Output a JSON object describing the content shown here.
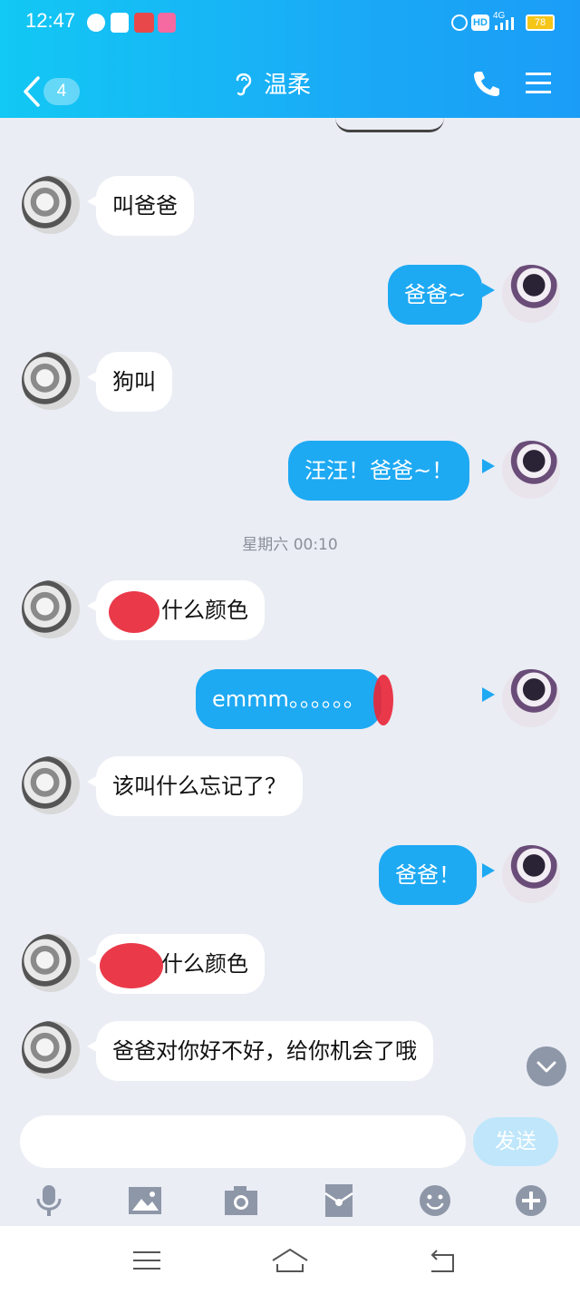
{
  "status_bar": {
    "time": "12:47",
    "hd_label": "HD",
    "network_label": "4G",
    "battery": "78"
  },
  "header": {
    "back_count": "4",
    "title": "温柔"
  },
  "messages": [
    {
      "side": "left",
      "text": "叫爸爸"
    },
    {
      "side": "right",
      "text": "爸爸~"
    },
    {
      "side": "left",
      "text": "狗叫"
    },
    {
      "side": "right",
      "text": "汪汪！爸爸~！"
    },
    {
      "side": "left",
      "text": "什么颜色"
    },
    {
      "side": "right",
      "text": "emmm。。。。。。"
    },
    {
      "side": "left",
      "text": "该叫什么忘记了？"
    },
    {
      "side": "right",
      "text": "爸爸！"
    },
    {
      "side": "left",
      "text": "什么颜色"
    },
    {
      "side": "left",
      "text": "爸爸对你好不好，给你机会了哦"
    }
  ],
  "timestamp": "星期六  00:10",
  "input": {
    "value": "",
    "send_label": "发送"
  },
  "toolbar": [
    "microphone-icon",
    "image-icon",
    "camera-icon",
    "red-envelope-icon",
    "emoji-icon",
    "plus-icon"
  ],
  "colors": {
    "header_start": "#12c8f4",
    "header_end": "#1b9df7",
    "bubble_right": "#1ea9f3",
    "background": "#eaedf4",
    "send_disabled": "#bfe6fb"
  }
}
